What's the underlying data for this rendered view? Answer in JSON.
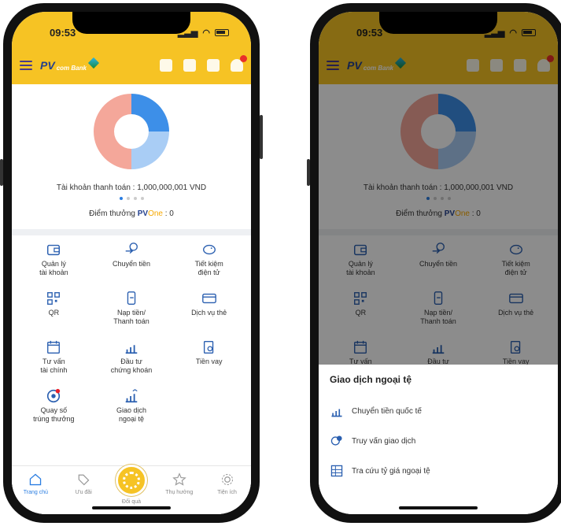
{
  "status": {
    "time": "09:53"
  },
  "brand": {
    "name": "PV",
    "sub": "com Bank"
  },
  "account": {
    "text": "Tài khoản thanh toán : 1,000,000,001 VND"
  },
  "points": {
    "label": "Điểm thưởng",
    "pv": "PV",
    "one": "One",
    "value": ": 0"
  },
  "donut": {
    "segments": [
      {
        "name": "blue",
        "fraction": 0.25,
        "color": "#3d8fe8"
      },
      {
        "name": "light-blue",
        "fraction": 0.25,
        "color": "#a9cdf5"
      },
      {
        "name": "salmon",
        "fraction": 0.5,
        "color": "#f4a79a"
      }
    ]
  },
  "menu": [
    {
      "label": "Quản lý\ntài khoản",
      "icon": "wallet-icon"
    },
    {
      "label": "Chuyển tiền",
      "icon": "transfer-icon"
    },
    {
      "label": "Tiết kiệm\nđiện tử",
      "icon": "piggy-bank-icon"
    },
    {
      "label": "QR",
      "icon": "qr-icon"
    },
    {
      "label": "Nạp tiền/\nThanh toán",
      "icon": "topup-icon"
    },
    {
      "label": "Dịch vụ thẻ",
      "icon": "card-icon"
    },
    {
      "label": "Tư vấn\ntài chính",
      "icon": "calendar-icon"
    },
    {
      "label": "Đầu tư\nchứng khoán",
      "icon": "invest-icon"
    },
    {
      "label": "Tiền vay",
      "icon": "loan-icon"
    },
    {
      "label": "Quay số\ntrúng thưởng",
      "icon": "lottery-icon"
    },
    {
      "label": "Giao dịch\nngoại tệ",
      "icon": "forex-icon"
    }
  ],
  "bottom_nav": [
    {
      "label": "Trang chủ",
      "icon": "home-icon"
    },
    {
      "label": "Ưu đãi",
      "icon": "tag-icon"
    },
    {
      "label": "Đổi quà",
      "icon": "gift-icon"
    },
    {
      "label": "Thụ hưởng",
      "icon": "star-icon"
    },
    {
      "label": "Tiện ích",
      "icon": "gear-icon"
    }
  ],
  "sheet": {
    "title": "Giao dịch ngoại tệ",
    "items": [
      {
        "label": "Chuyển tiền quốc tế",
        "icon": "intl-transfer-icon"
      },
      {
        "label": "Truy vấn giao dịch",
        "icon": "query-icon"
      },
      {
        "label": "Tra cứu tỷ giá ngoại tệ",
        "icon": "exchange-rate-icon"
      }
    ]
  },
  "colors": {
    "brand_yellow": "#f6c324",
    "accent_blue": "#2a7de1"
  }
}
